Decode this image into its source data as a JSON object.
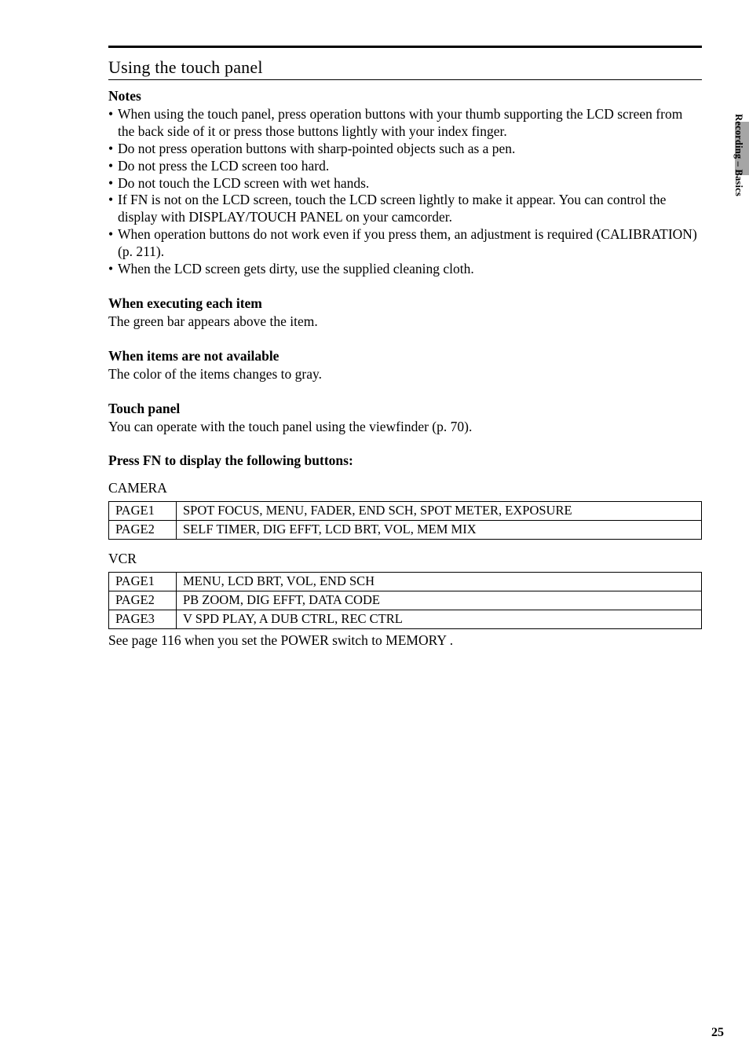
{
  "header": {
    "title": "Using the touch panel"
  },
  "notes": {
    "heading": "Notes",
    "items": [
      "When using the touch panel, press operation buttons with your thumb supporting the LCD screen from the back side of it or press those buttons lightly with your index finger.",
      "Do not press operation buttons with sharp-pointed objects such as a pen.",
      "Do not press the LCD screen too hard.",
      "Do not touch the LCD screen with wet hands.",
      "If FN is not on the LCD screen, touch the LCD screen lightly to make it appear. You can control the display with DISPLAY/TOUCH PANEL on your camcorder.",
      "When operation buttons do not work even if you press them, an adjustment is required (CALIBRATION) (p. 211).",
      "When the LCD screen gets dirty, use the supplied cleaning cloth."
    ]
  },
  "sections": [
    {
      "heading": "When executing each item",
      "body": "The green bar appears above the item."
    },
    {
      "heading": "When items are not available",
      "body": "The color of the items changes to gray."
    },
    {
      "heading": "Touch panel",
      "body": "You can operate with the touch panel using the viewfinder (p. 70)."
    },
    {
      "heading": "Press FN to display the following buttons:",
      "body": ""
    }
  ],
  "tables": {
    "camera": {
      "label": "CAMERA",
      "rows": [
        {
          "page": "PAGE1",
          "content": "SPOT FOCUS, MENU, FADER, END SCH, SPOT METER, EXPOSURE"
        },
        {
          "page": "PAGE2",
          "content": "SELF TIMER, DIG EFFT, LCD BRT, VOL, MEM MIX"
        }
      ]
    },
    "vcr": {
      "label": "VCR",
      "rows": [
        {
          "page": "PAGE1",
          "content": "MENU, LCD BRT, VOL, END SCH"
        },
        {
          "page": "PAGE2",
          "content": "PB ZOOM, DIG EFFT, DATA CODE"
        },
        {
          "page": "PAGE3",
          "content": "V SPD PLAY, A DUB CTRL, REC CTRL"
        }
      ]
    },
    "footnote": "See page 116 when you set the POWER switch to MEMORY ."
  },
  "sideLabel": "Recording – Basics",
  "pageNumber": "25"
}
